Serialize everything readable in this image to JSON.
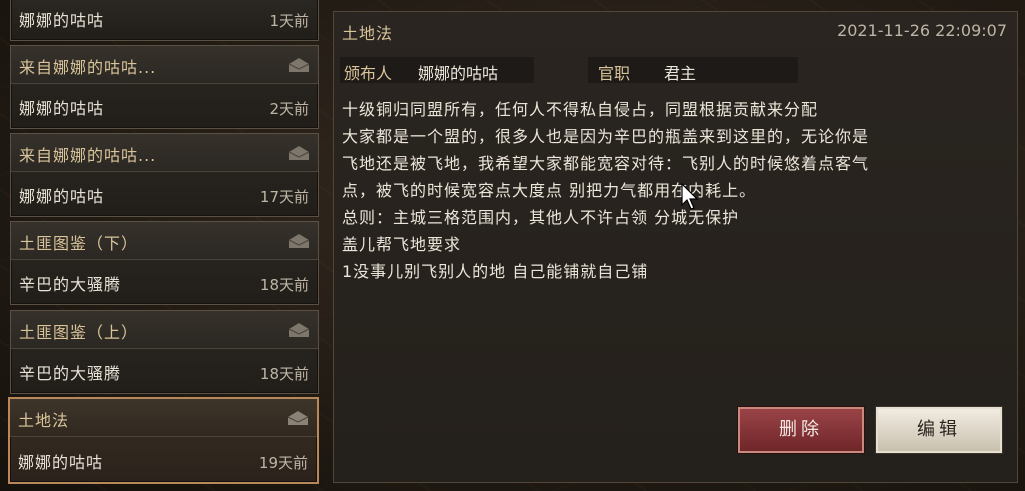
{
  "mail_list": [
    {
      "subject": "",
      "sender": "娜娜的咕咕",
      "time": "1天前"
    },
    {
      "subject": "来自娜娜的咕咕...",
      "sender": "娜娜的咕咕",
      "time": "2天前"
    },
    {
      "subject": "来自娜娜的咕咕...",
      "sender": "娜娜的咕咕",
      "time": "17天前"
    },
    {
      "subject": "土匪图鉴（下）",
      "sender": "辛巴的大骚腾",
      "time": "18天前"
    },
    {
      "subject": "土匪图鉴（上）",
      "sender": "辛巴的大骚腾",
      "time": "18天前"
    },
    {
      "subject": "土地法",
      "sender": "娜娜的咕咕",
      "time": "19天前"
    }
  ],
  "detail": {
    "title": "土地法",
    "date": "2021-11-26 22:09:07",
    "publisher_label": "颁布人",
    "publisher": "娜娜的咕咕",
    "rank_label": "官职",
    "rank": "君主",
    "body_lines": [
      "十级铜归同盟所有，任何人不得私自侵占，同盟根据贡献来分配",
      "",
      "大家都是一个盟的，很多人也是因为辛巴的瓶盖来到这里的，无论你是",
      "飞地还是被飞地，我希望大家都能宽容对待：飞别人的时候悠着点客气",
      "点，被飞的时候宽容点大度点 别把力气都用在内耗上。",
      "",
      "总则：主城三格范围内，其他人不许占领 分城无保护",
      "",
      "盖儿帮飞地要求",
      "1没事儿别飞别人的地 自己能铺就自己铺"
    ]
  },
  "buttons": {
    "delete": "删除",
    "edit": "编辑"
  },
  "colors": {
    "accent": "#d9c49a",
    "delete_btn": "#8a3a3d",
    "edit_btn": "#e6dfd1",
    "selected_border": "#b8885a"
  }
}
